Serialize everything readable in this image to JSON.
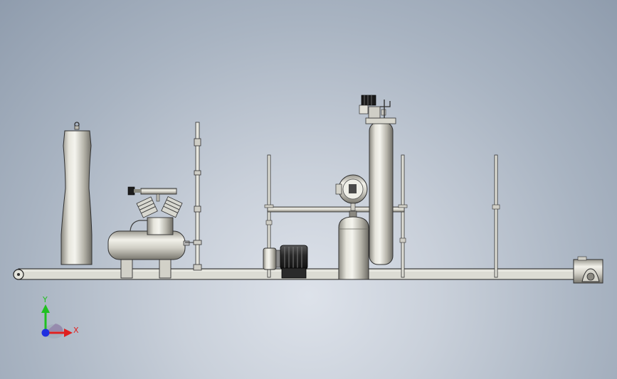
{
  "triad": {
    "y_label": "Y",
    "x_label": "X",
    "y_color": "#20c020",
    "x_color": "#e02020",
    "z_color": "#2030e0"
  },
  "components": [
    "vertical-gas-cylinder-shell",
    "air-compressor",
    "vertical-probe-pipe",
    "pipe-rack-frame",
    "electric-motor",
    "gas-cylinder-with-regulator",
    "pressure-gauge",
    "pressure-vessel",
    "end-sheave"
  ],
  "colors": {
    "steel_light": "#eeeee6",
    "steel_mid": "#c8c6bd",
    "steel_dark": "#6f6d66",
    "outline": "#202020",
    "motor": "#3a3a3a"
  }
}
